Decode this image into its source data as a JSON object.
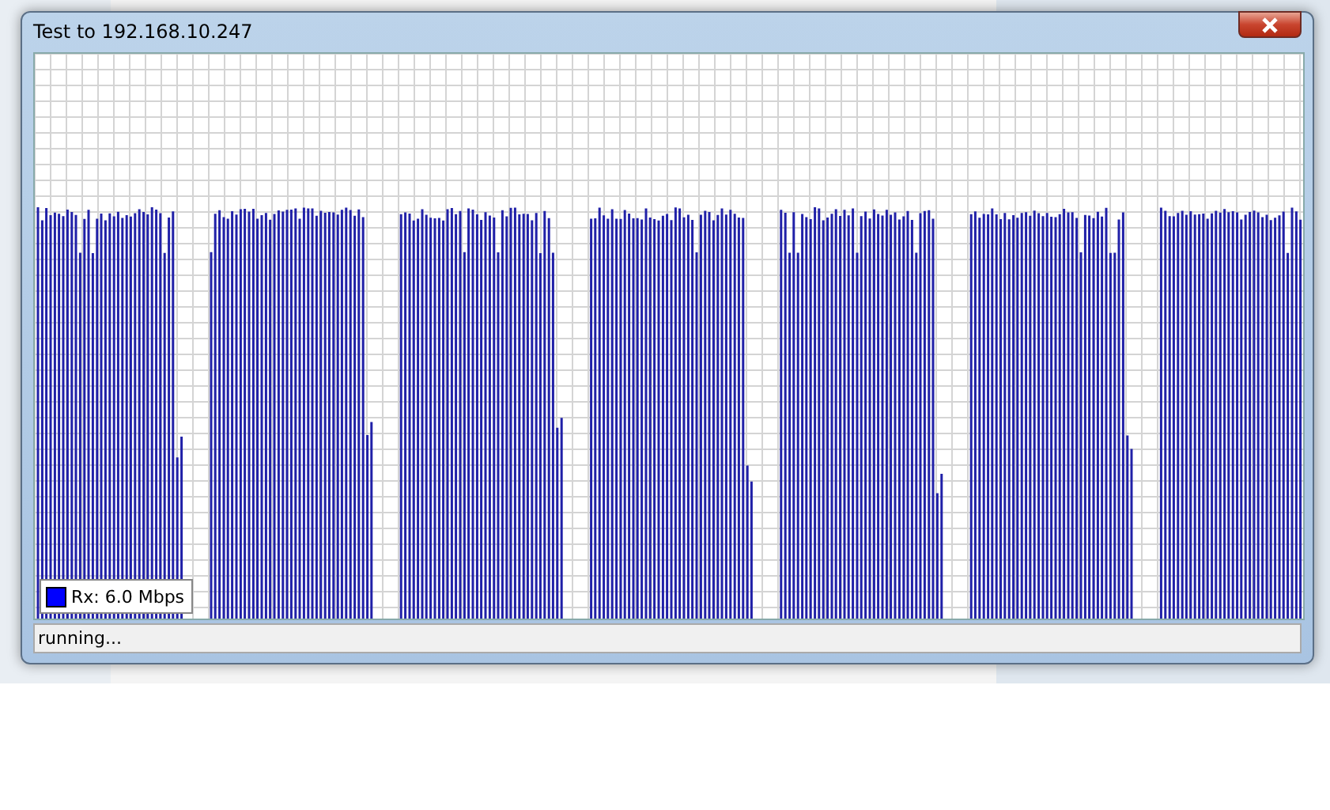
{
  "window": {
    "title": "Test to 192.168.10.247"
  },
  "legend": {
    "label": "Rx: 6.0 Mbps",
    "color": "#0000ff"
  },
  "status_bar": {
    "text": "running..."
  }
}
